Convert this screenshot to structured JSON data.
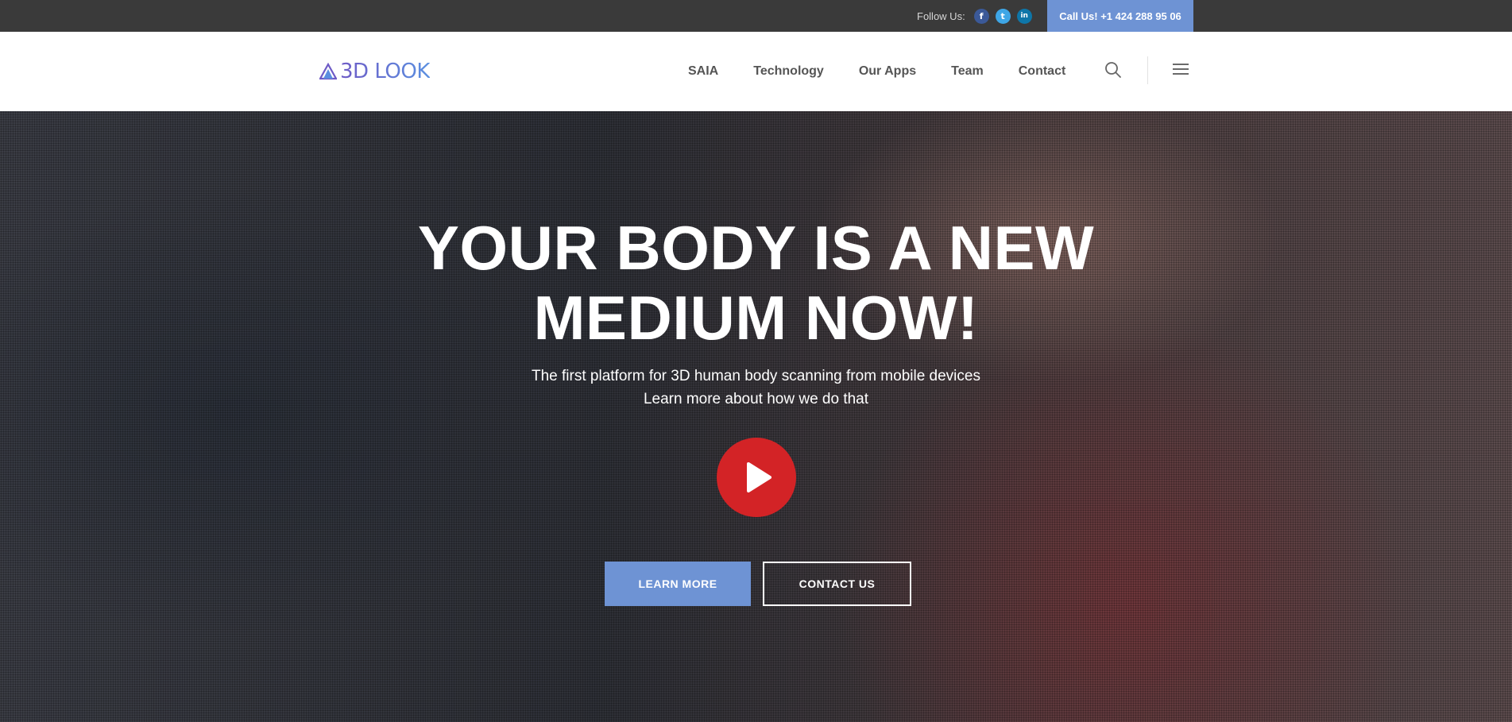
{
  "topbar": {
    "follow_label": "Follow Us:",
    "social": [
      {
        "icon": "facebook-icon",
        "glyph": "f"
      },
      {
        "icon": "twitter-icon",
        "glyph": "t"
      },
      {
        "icon": "linkedin-icon",
        "glyph": "in"
      }
    ],
    "call_us": "Call Us! +1 424 288 95 06"
  },
  "header": {
    "logo_text": "3D LOOK",
    "nav": [
      "SAIA",
      "Technology",
      "Our Apps",
      "Team",
      "Contact"
    ]
  },
  "hero": {
    "title_line1": "YOUR BODY IS A NEW",
    "title_line2": "MEDIUM NOW!",
    "subtitle_line1": "The first platform for 3D human body scanning from mobile devices",
    "subtitle_line2": "Learn more about how we do that",
    "learn_more": "LEARN MORE",
    "contact_us": "CONTACT US"
  },
  "colors": {
    "accent": "#6e93d4",
    "play": "#d32326",
    "topbar_bg": "#3a3a3a"
  }
}
